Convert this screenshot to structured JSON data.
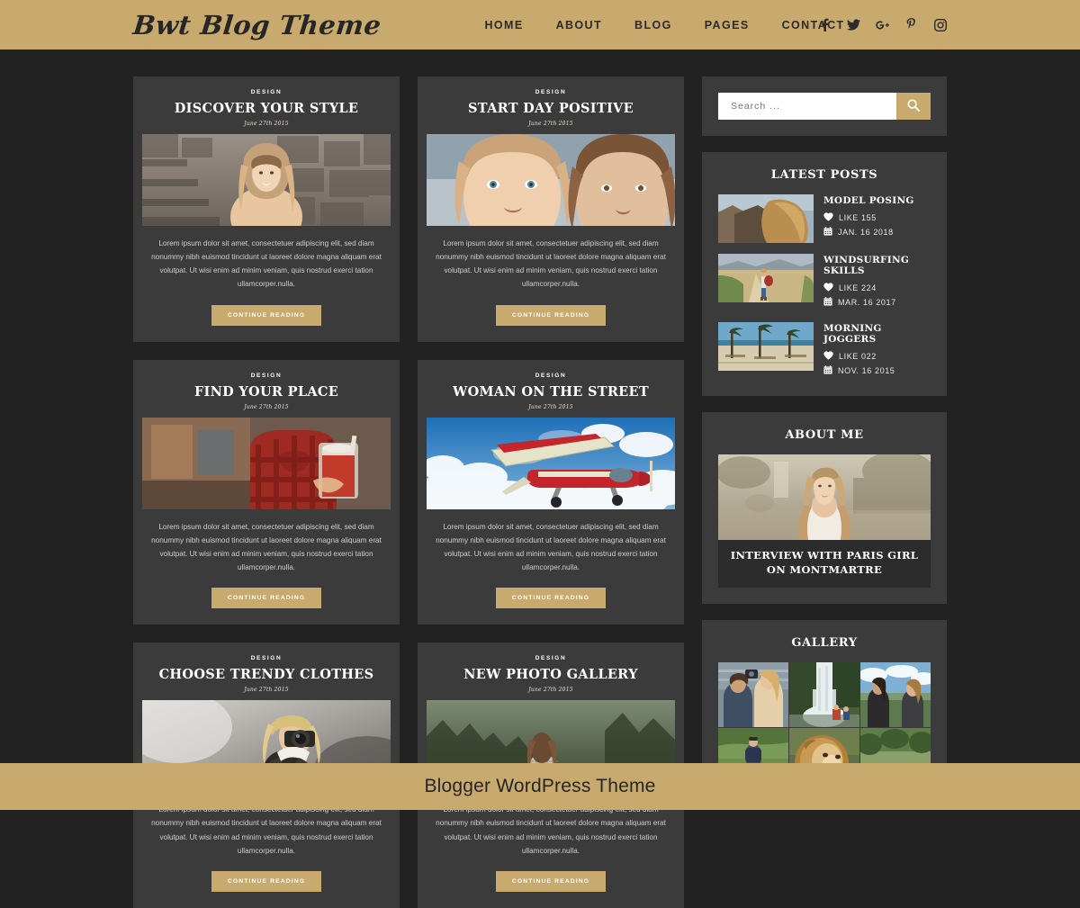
{
  "colors": {
    "gold": "#c8a96e",
    "page_bg": "#222222",
    "card_bg": "#3b3b3b",
    "caption_bg": "#2c2c2c",
    "text_light": "#ffffff"
  },
  "header": {
    "logo": "Bwt Blog Theme",
    "nav": [
      {
        "label": "HOME"
      },
      {
        "label": "ABOUT"
      },
      {
        "label": "BLOG"
      },
      {
        "label": "PAGES"
      },
      {
        "label": "CONTACT"
      }
    ],
    "social": [
      {
        "name": "facebook-icon"
      },
      {
        "name": "twitter-icon"
      },
      {
        "name": "google-plus-icon"
      },
      {
        "name": "pinterest-icon"
      },
      {
        "name": "instagram-icon"
      }
    ]
  },
  "posts": [
    {
      "category": "DESIGN",
      "title": "DISCOVER YOUR STYLE",
      "date": "June 27th 2015",
      "excerpt": "Lorem ipsum dolor sit amet, consectetuer adipiscing elit, sed diam nonummy nibh euismod tincidunt ut laoreet dolore magna aliquam erat volutpat. Ut wisi enim ad minim veniam, quis nostrud exerci tation ullamcorper.nulla.",
      "button": "CONTINUE READING",
      "image": "woman-smiling-stone-wall"
    },
    {
      "category": "DESIGN",
      "title": "START DAY POSITIVE",
      "date": "June 27th 2015",
      "excerpt": "Lorem ipsum dolor sit amet, consectetuer adipiscing elit, sed diam nonummy nibh euismod tincidunt ut laoreet dolore magna aliquam erat volutpat. Ut wisi enim ad minim veniam, quis nostrud exerci tation ullamcorper.nulla.",
      "button": "CONTINUE READING",
      "image": "two-women-portrait"
    },
    {
      "category": "DESIGN",
      "title": "FIND YOUR PLACE",
      "date": "June 27th 2015",
      "excerpt": "Lorem ipsum dolor sit amet, consectetuer adipiscing elit, sed diam nonummy nibh euismod tincidunt ut laoreet dolore magna aliquam erat volutpat. Ut wisi enim ad minim veniam, quis nostrud exerci tation ullamcorper.nulla.",
      "button": "CONTINUE READING",
      "image": "person-red-shirt-drink"
    },
    {
      "category": "DESIGN",
      "title": "WOMAN ON THE STREET",
      "date": "June 27th 2015",
      "excerpt": "Lorem ipsum dolor sit amet, consectetuer adipiscing elit, sed diam nonummy nibh euismod tincidunt ut laoreet dolore magna aliquam erat volutpat. Ut wisi enim ad minim veniam, quis nostrud exerci tation ullamcorper.nulla.",
      "button": "CONTINUE READING",
      "image": "biplane-in-clouds"
    },
    {
      "category": "DESIGN",
      "title": "CHOOSE TRENDY CLOTHES",
      "date": "June 27th 2015",
      "excerpt": "Lorem ipsum dolor sit amet, consectetuer adipiscing elit, sed diam nonummy nibh euismod tincidunt ut laoreet dolore magna aliquam erat volutpat. Ut wisi enim ad minim veniam, quis nostrud exerci tation ullamcorper.nulla.",
      "button": "CONTINUE READING",
      "image": "photographer-woman-camera"
    },
    {
      "category": "DESIGN",
      "title": "NEW PHOTO GALLERY",
      "date": "June 27th 2015",
      "excerpt": "Lorem ipsum dolor sit amet, consectetuer adipiscing elit, sed diam nonummy nibh euismod tincidunt ut laoreet dolore magna aliquam erat volutpat. Ut wisi enim ad minim veniam, quis nostrud exerci tation ullamcorper.nulla.",
      "button": "CONTINUE READING",
      "image": "woman-on-rock-forest"
    }
  ],
  "sidebar": {
    "search": {
      "placeholder": "Search ...",
      "value": "",
      "icon": "search-icon"
    },
    "latest_posts": {
      "title": "LATEST POSTS",
      "items": [
        {
          "title": "MODEL POSING",
          "like_label": "LIKE 155",
          "date": "JAN. 16 2018",
          "image": "model-long-hair-rocks"
        },
        {
          "title": "WINDSURFING SKILLS",
          "like_label": "LIKE 224",
          "date": "MAR. 16 2017",
          "image": "backpacker-dirt-road"
        },
        {
          "title": "MORNING JOGGERS",
          "like_label": "LIKE 022",
          "date": "NOV. 16 2015",
          "image": "palm-trees-beach"
        }
      ]
    },
    "about_me": {
      "title": "ABOUT ME",
      "image": "blonde-woman-white-top",
      "caption": "INTERVIEW WITH PARIS GIRL ON MONTMARTRE"
    },
    "gallery": {
      "title": "GALLERY",
      "items": [
        {
          "image": "two-girls-taking-photo"
        },
        {
          "image": "waterfall-jungle"
        },
        {
          "image": "two-women-on-cliff"
        },
        {
          "image": "hiker-green-hills"
        },
        {
          "image": "lion-portrait"
        },
        {
          "image": "red-vintage-car"
        }
      ]
    }
  },
  "footer": {
    "text": "Blogger WordPress Theme"
  }
}
